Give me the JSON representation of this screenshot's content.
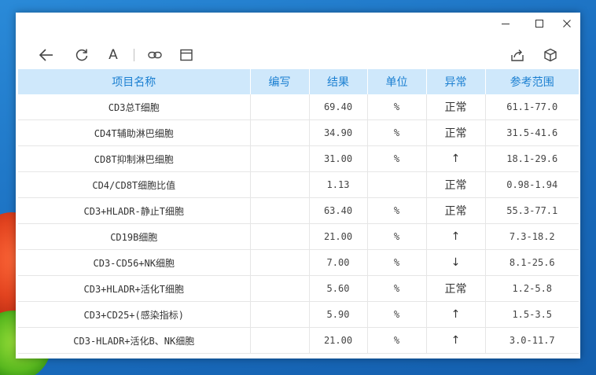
{
  "window": {
    "icons": {
      "minimize": "minimize-icon",
      "maximize": "maximize-icon",
      "close": "close-icon"
    }
  },
  "toolbar": {
    "font_label": "A",
    "icons": [
      "back-arrow-icon",
      "refresh-icon",
      "font-icon",
      "link-icon",
      "window-icon",
      "share-icon",
      "box-icon"
    ]
  },
  "table": {
    "headers": [
      "项目名称",
      "编写",
      "结果",
      "单位",
      "异常",
      "参考范围"
    ],
    "rows": [
      {
        "name": "CD3总T细胞",
        "code": "",
        "result": "69.40",
        "unit": "%",
        "flag": "正常",
        "range": "61.1-77.0"
      },
      {
        "name": "CD4T辅助淋巴细胞",
        "code": "",
        "result": "34.90",
        "unit": "%",
        "flag": "正常",
        "range": "31.5-41.6"
      },
      {
        "name": "CD8T抑制淋巴细胞",
        "code": "",
        "result": "31.00",
        "unit": "%",
        "flag": "↑",
        "range": "18.1-29.6"
      },
      {
        "name": "CD4/CD8T细胞比值",
        "code": "",
        "result": "1.13",
        "unit": "",
        "flag": "正常",
        "range": "0.98-1.94"
      },
      {
        "name": "CD3+HLADR-静止T细胞",
        "code": "",
        "result": "63.40",
        "unit": "%",
        "flag": "正常",
        "range": "55.3-77.1"
      },
      {
        "name": "CD19B细胞",
        "code": "",
        "result": "21.00",
        "unit": "%",
        "flag": "↑",
        "range": "7.3-18.2"
      },
      {
        "name": "CD3-CD56+NK细胞",
        "code": "",
        "result": "7.00",
        "unit": "%",
        "flag": "↓",
        "range": "8.1-25.6"
      },
      {
        "name": "CD3+HLADR+活化T细胞",
        "code": "",
        "result": "5.60",
        "unit": "%",
        "flag": "正常",
        "range": "1.2-5.8"
      },
      {
        "name": "CD3+CD25+(感染指标)",
        "code": "",
        "result": "5.90",
        "unit": "%",
        "flag": "↑",
        "range": "1.5-3.5"
      },
      {
        "name": "CD3-HLADR+活化B、NK细胞",
        "code": "",
        "result": "21.00",
        "unit": "%",
        "flag": "↑",
        "range": "3.0-11.7"
      }
    ]
  },
  "colors": {
    "header_bg": "#cfe8fb",
    "header_text": "#1b7fd1",
    "desktop": "#1f78c8"
  }
}
